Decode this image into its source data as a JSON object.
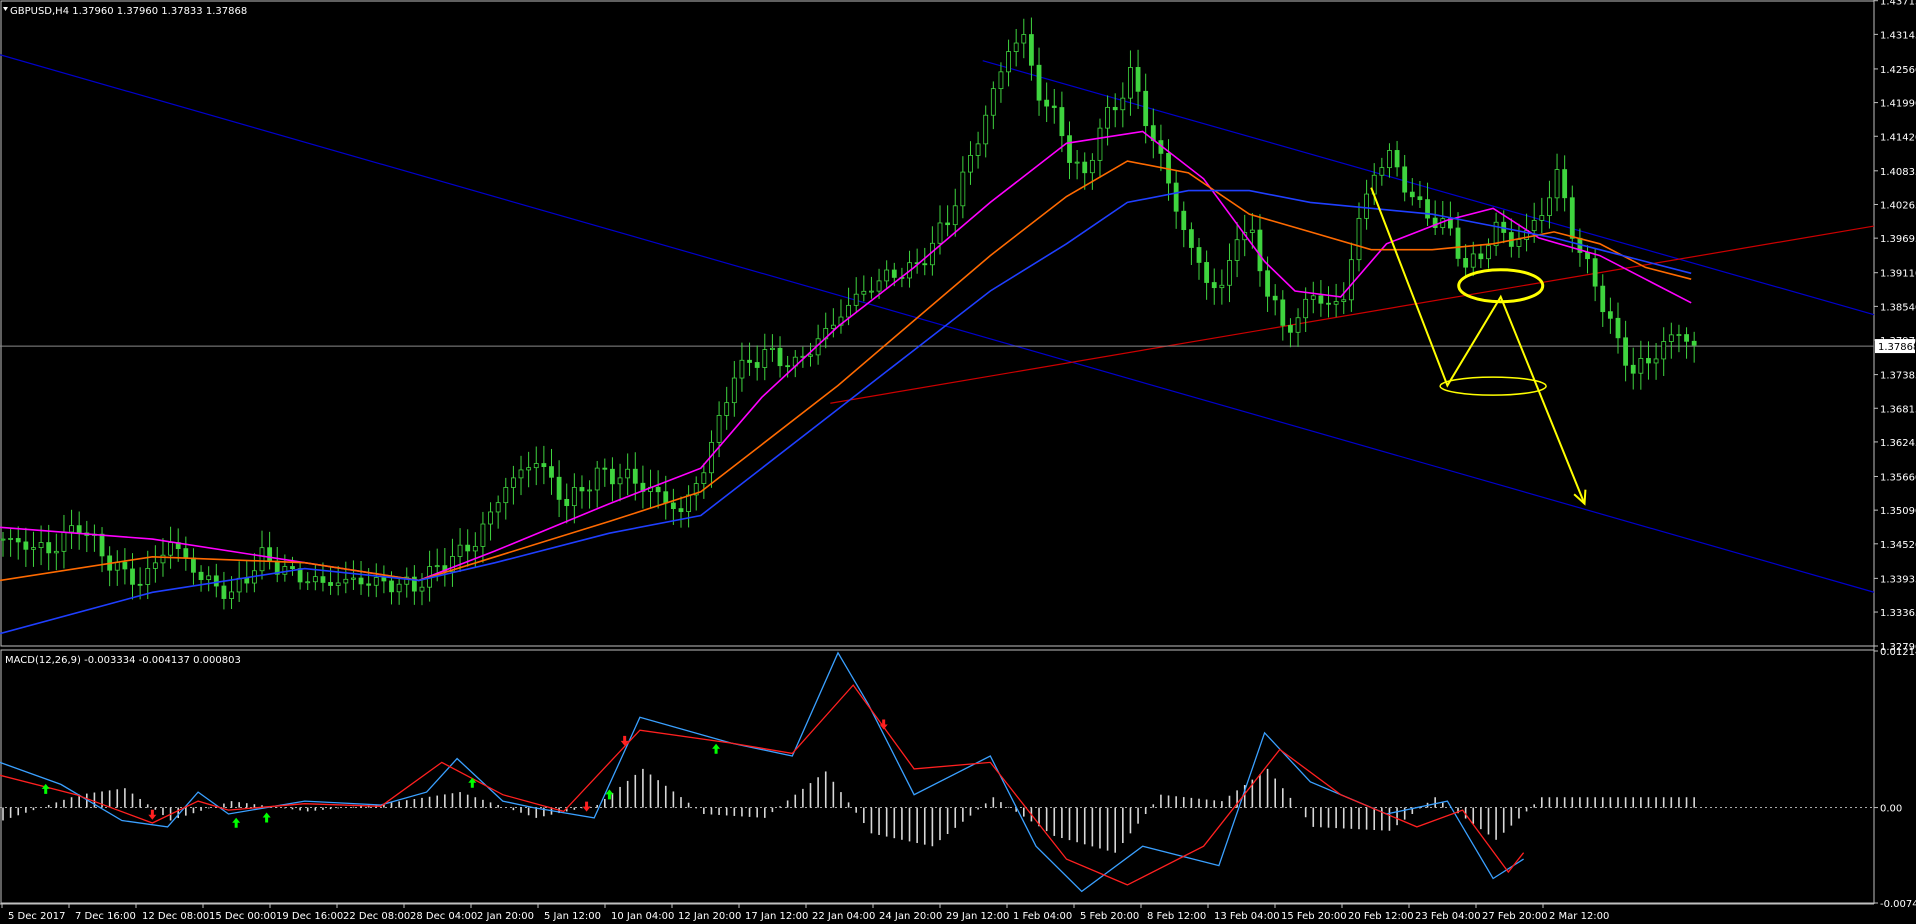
{
  "chart_data": [
    {
      "type": "candlestick",
      "title": "GBPUSD,H4  1.37960 1.37960 1.37833 1.37868",
      "symbol": "GBPUSD",
      "timeframe": "H4",
      "ohlc": {
        "open": 1.3796,
        "high": 1.3796,
        "low": 1.37833,
        "close": 1.37868
      },
      "current_price_label": "1.37868",
      "ylim": [
        1.3279,
        1.4371
      ],
      "y_ticks": [
        "1.43715",
        "1.43145",
        "1.42560",
        "1.41990",
        "1.41420",
        "1.40835",
        "1.40265",
        "1.39695",
        "1.39110",
        "1.38540",
        "1.37970",
        "1.37385",
        "1.36815",
        "1.36245",
        "1.35660",
        "1.35090",
        "1.34520",
        "1.33935",
        "1.33365",
        "1.32790"
      ],
      "x_ticks": [
        "5 Dec 2017",
        "7 Dec 16:00",
        "12 Dec 08:00",
        "15 Dec 00:00",
        "19 Dec 16:00",
        "22 Dec 08:00",
        "28 Dec 04:00",
        "2 Jan 20:00",
        "5 Jan 12:00",
        "10 Jan 04:00",
        "12 Jan 20:00",
        "17 Jan 12:00",
        "22 Jan 04:00",
        "24 Jan 20:00",
        "29 Jan 12:00",
        "1 Feb 04:00",
        "5 Feb 20:00",
        "8 Feb 12:00",
        "13 Feb 04:00",
        "15 Feb 20:00",
        "20 Feb 12:00",
        "23 Feb 04:00",
        "27 Feb 20:00",
        "2 Mar 12:00"
      ],
      "close_path": [
        [
          0,
          1.346
        ],
        [
          6,
          1.344
        ],
        [
          10,
          1.3485
        ],
        [
          14,
          1.342
        ],
        [
          18,
          1.3385
        ],
        [
          22,
          1.3455
        ],
        [
          26,
          1.3395
        ],
        [
          30,
          1.3365
        ],
        [
          34,
          1.343
        ],
        [
          38,
          1.34
        ],
        [
          42,
          1.3385
        ],
        [
          46,
          1.339
        ],
        [
          50,
          1.3385
        ],
        [
          54,
          1.338
        ],
        [
          58,
          1.342
        ],
        [
          62,
          1.3455
        ],
        [
          66,
          1.355
        ],
        [
          70,
          1.3595
        ],
        [
          74,
          1.352
        ],
        [
          78,
          1.357
        ],
        [
          82,
          1.3565
        ],
        [
          86,
          1.3535
        ],
        [
          89,
          1.3505
        ],
        [
          92,
          1.358
        ],
        [
          96,
          1.374
        ],
        [
          100,
          1.3775
        ],
        [
          104,
          1.3755
        ],
        [
          108,
          1.381
        ],
        [
          112,
          1.387
        ],
        [
          116,
          1.3905
        ],
        [
          120,
          1.392
        ],
        [
          124,
          1.4
        ],
        [
          128,
          1.414
        ],
        [
          132,
          1.429
        ],
        [
          134,
          1.431
        ],
        [
          136,
          1.421
        ],
        [
          138,
          1.418
        ],
        [
          140,
          1.411
        ],
        [
          142,
          1.407
        ],
        [
          144,
          1.416
        ],
        [
          146,
          1.419
        ],
        [
          148,
          1.425
        ],
        [
          150,
          1.417
        ],
        [
          152,
          1.4105
        ],
        [
          154,
          1.402
        ],
        [
          156,
          1.395
        ],
        [
          158,
          1.39
        ],
        [
          160,
          1.388
        ],
        [
          162,
          1.398
        ],
        [
          164,
          1.397
        ],
        [
          166,
          1.388
        ],
        [
          168,
          1.382
        ],
        [
          170,
          1.383
        ],
        [
          172,
          1.388
        ],
        [
          174,
          1.385
        ],
        [
          176,
          1.387
        ],
        [
          178,
          1.4
        ],
        [
          180,
          1.408
        ],
        [
          182,
          1.411
        ],
        [
          184,
          1.406
        ],
        [
          186,
          1.402
        ],
        [
          188,
          1.4
        ],
        [
          190,
          1.398
        ],
        [
          192,
          1.392
        ],
        [
          194,
          1.394
        ],
        [
          196,
          1.399
        ],
        [
          198,
          1.396
        ],
        [
          200,
          1.398
        ],
        [
          202,
          1.401
        ],
        [
          204,
          1.408
        ],
        [
          206,
          1.398
        ],
        [
          208,
          1.392
        ],
        [
          210,
          1.386
        ],
        [
          212,
          1.379
        ],
        [
          214,
          1.3745
        ],
        [
          216,
          1.376
        ],
        [
          218,
          1.379
        ],
        [
          220,
          1.381
        ],
        [
          222,
          1.3787
        ]
      ],
      "moving_averages": [
        {
          "color": "#ff00ff",
          "points": [
            [
              0,
              1.348
            ],
            [
              20,
              1.346
            ],
            [
              40,
              1.342
            ],
            [
              55,
              1.339
            ],
            [
              65,
              1.344
            ],
            [
              80,
              1.352
            ],
            [
              92,
              1.358
            ],
            [
              100,
              1.37
            ],
            [
              110,
              1.382
            ],
            [
              120,
              1.392
            ],
            [
              130,
              1.403
            ],
            [
              140,
              1.413
            ],
            [
              150,
              1.415
            ],
            [
              158,
              1.407
            ],
            [
              166,
              1.393
            ],
            [
              170,
              1.388
            ],
            [
              176,
              1.387
            ],
            [
              182,
              1.396
            ],
            [
              190,
              1.4
            ],
            [
              196,
              1.402
            ],
            [
              202,
              1.397
            ],
            [
              210,
              1.394
            ],
            [
              216,
              1.39
            ],
            [
              222,
              1.386
            ]
          ]
        },
        {
          "color": "#ff6a00",
          "points": [
            [
              0,
              1.339
            ],
            [
              20,
              1.343
            ],
            [
              40,
              1.342
            ],
            [
              55,
              1.339
            ],
            [
              65,
              1.343
            ],
            [
              80,
              1.349
            ],
            [
              92,
              1.354
            ],
            [
              100,
              1.362
            ],
            [
              110,
              1.372
            ],
            [
              120,
              1.383
            ],
            [
              130,
              1.394
            ],
            [
              140,
              1.404
            ],
            [
              148,
              1.41
            ],
            [
              156,
              1.408
            ],
            [
              164,
              1.401
            ],
            [
              172,
              1.398
            ],
            [
              180,
              1.395
            ],
            [
              188,
              1.395
            ],
            [
              196,
              1.396
            ],
            [
              204,
              1.398
            ],
            [
              210,
              1.396
            ],
            [
              216,
              1.392
            ],
            [
              222,
              1.39
            ]
          ]
        },
        {
          "color": "#1f3fff",
          "points": [
            [
              0,
              1.33
            ],
            [
              20,
              1.337
            ],
            [
              40,
              1.341
            ],
            [
              55,
              1.339
            ],
            [
              65,
              1.342
            ],
            [
              80,
              1.347
            ],
            [
              92,
              1.35
            ],
            [
              100,
              1.358
            ],
            [
              110,
              1.368
            ],
            [
              120,
              1.378
            ],
            [
              130,
              1.388
            ],
            [
              140,
              1.396
            ],
            [
              148,
              1.403
            ],
            [
              156,
              1.405
            ],
            [
              164,
              1.405
            ],
            [
              172,
              1.403
            ],
            [
              180,
              1.402
            ],
            [
              188,
              1.401
            ],
            [
              196,
              1.399
            ],
            [
              204,
              1.397
            ],
            [
              210,
              1.395
            ],
            [
              216,
              1.393
            ],
            [
              222,
              1.391
            ]
          ]
        }
      ],
      "trendlines": [
        {
          "color": "#0000cc",
          "from": [
            0,
            1.428
          ],
          "to": [
            246,
            1.337
          ]
        },
        {
          "color": "#0000cc",
          "from": [
            129,
            1.427
          ],
          "to": [
            246,
            1.384
          ]
        },
        {
          "color": "#cc0000",
          "from": [
            109,
            1.369
          ],
          "to": [
            246,
            1.399
          ]
        }
      ],
      "annotations": {
        "color": "#ffff00",
        "zigzag": [
          [
            180,
            1.4055
          ],
          [
            190,
            1.372
          ],
          [
            197,
            1.387
          ],
          [
            208,
            1.352
          ]
        ],
        "ellipses": [
          {
            "cx": 197,
            "cy": 1.3889
          },
          {
            "cx": 196,
            "cy": 1.3719
          }
        ]
      }
    },
    {
      "type": "macd",
      "title": "MACD(12,26,9) -0.003334 -0.004137 0.000803",
      "ylim": [
        -0.007401,
        0.012141
      ],
      "y_ticks": [
        "0.012141",
        "0.00",
        "-0.007401"
      ],
      "macd_line": [
        [
          0,
          0.0035
        ],
        [
          8,
          0.0018
        ],
        [
          16,
          -0.001
        ],
        [
          22,
          -0.0015
        ],
        [
          26,
          0.0012
        ],
        [
          30,
          -0.0005
        ],
        [
          40,
          0.0005
        ],
        [
          50,
          0.0002
        ],
        [
          56,
          0.0012
        ],
        [
          60,
          0.0038
        ],
        [
          66,
          0.0005
        ],
        [
          70,
          0.0
        ],
        [
          78,
          -0.0008
        ],
        [
          84,
          0.007
        ],
        [
          96,
          0.005
        ],
        [
          104,
          0.004
        ],
        [
          110,
          0.012
        ],
        [
          114,
          0.008
        ],
        [
          120,
          0.001
        ],
        [
          130,
          0.004
        ],
        [
          136,
          -0.003
        ],
        [
          142,
          -0.0065
        ],
        [
          150,
          -0.003
        ],
        [
          160,
          -0.0045
        ],
        [
          166,
          0.0058
        ],
        [
          172,
          0.002
        ],
        [
          182,
          -0.0005
        ],
        [
          190,
          0.0005
        ],
        [
          196,
          -0.0055
        ],
        [
          200,
          -0.004
        ]
      ],
      "signal_line": [
        [
          0,
          0.0025
        ],
        [
          10,
          0.001
        ],
        [
          20,
          -0.0012
        ],
        [
          26,
          0.0005
        ],
        [
          30,
          -0.0002
        ],
        [
          40,
          0.0003
        ],
        [
          50,
          0.0001
        ],
        [
          58,
          0.0035
        ],
        [
          66,
          0.001
        ],
        [
          74,
          -0.0003
        ],
        [
          84,
          0.006
        ],
        [
          96,
          0.005
        ],
        [
          104,
          0.0042
        ],
        [
          112,
          0.0095
        ],
        [
          120,
          0.003
        ],
        [
          130,
          0.0035
        ],
        [
          140,
          -0.004
        ],
        [
          148,
          -0.006
        ],
        [
          158,
          -0.003
        ],
        [
          168,
          0.0045
        ],
        [
          176,
          0.001
        ],
        [
          186,
          -0.0015
        ],
        [
          192,
          -0.0002
        ],
        [
          198,
          -0.005
        ],
        [
          200,
          -0.0035
        ]
      ],
      "histogram": [
        [
          0,
          -0.001
        ],
        [
          10,
          0.001
        ],
        [
          16,
          0.0015
        ],
        [
          22,
          -0.001
        ],
        [
          30,
          0.0005
        ],
        [
          40,
          -0.0003
        ],
        [
          50,
          0.0003
        ],
        [
          60,
          0.0012
        ],
        [
          70,
          -0.0008
        ],
        [
          78,
          0.0002
        ],
        [
          84,
          0.003
        ],
        [
          92,
          -0.0005
        ],
        [
          100,
          -0.0008
        ],
        [
          108,
          0.0028
        ],
        [
          114,
          -0.002
        ],
        [
          122,
          -0.003
        ],
        [
          130,
          0.0008
        ],
        [
          138,
          -0.0022
        ],
        [
          146,
          -0.0035
        ],
        [
          152,
          0.001
        ],
        [
          160,
          0.0005
        ],
        [
          166,
          0.003
        ],
        [
          172,
          -0.0015
        ],
        [
          182,
          -0.0018
        ],
        [
          188,
          0.0008
        ],
        [
          196,
          -0.0025
        ],
        [
          202,
          0.0008
        ]
      ],
      "arrows": [
        {
          "x": 6,
          "direction": "up",
          "color": "#00ff00"
        },
        {
          "x": 20,
          "direction": "down",
          "color": "#ff2020"
        },
        {
          "x": 31,
          "direction": "up",
          "color": "#00ff00"
        },
        {
          "x": 35,
          "direction": "up",
          "color": "#00ff00"
        },
        {
          "x": 62,
          "direction": "up",
          "color": "#00ff00"
        },
        {
          "x": 77,
          "direction": "down",
          "color": "#ff2020"
        },
        {
          "x": 80,
          "direction": "up",
          "color": "#00ff00"
        },
        {
          "x": 82,
          "direction": "down",
          "color": "#ff2020"
        },
        {
          "x": 94,
          "direction": "up",
          "color": "#00ff00"
        },
        {
          "x": 116,
          "direction": "down",
          "color": "#ff2020"
        }
      ]
    }
  ]
}
